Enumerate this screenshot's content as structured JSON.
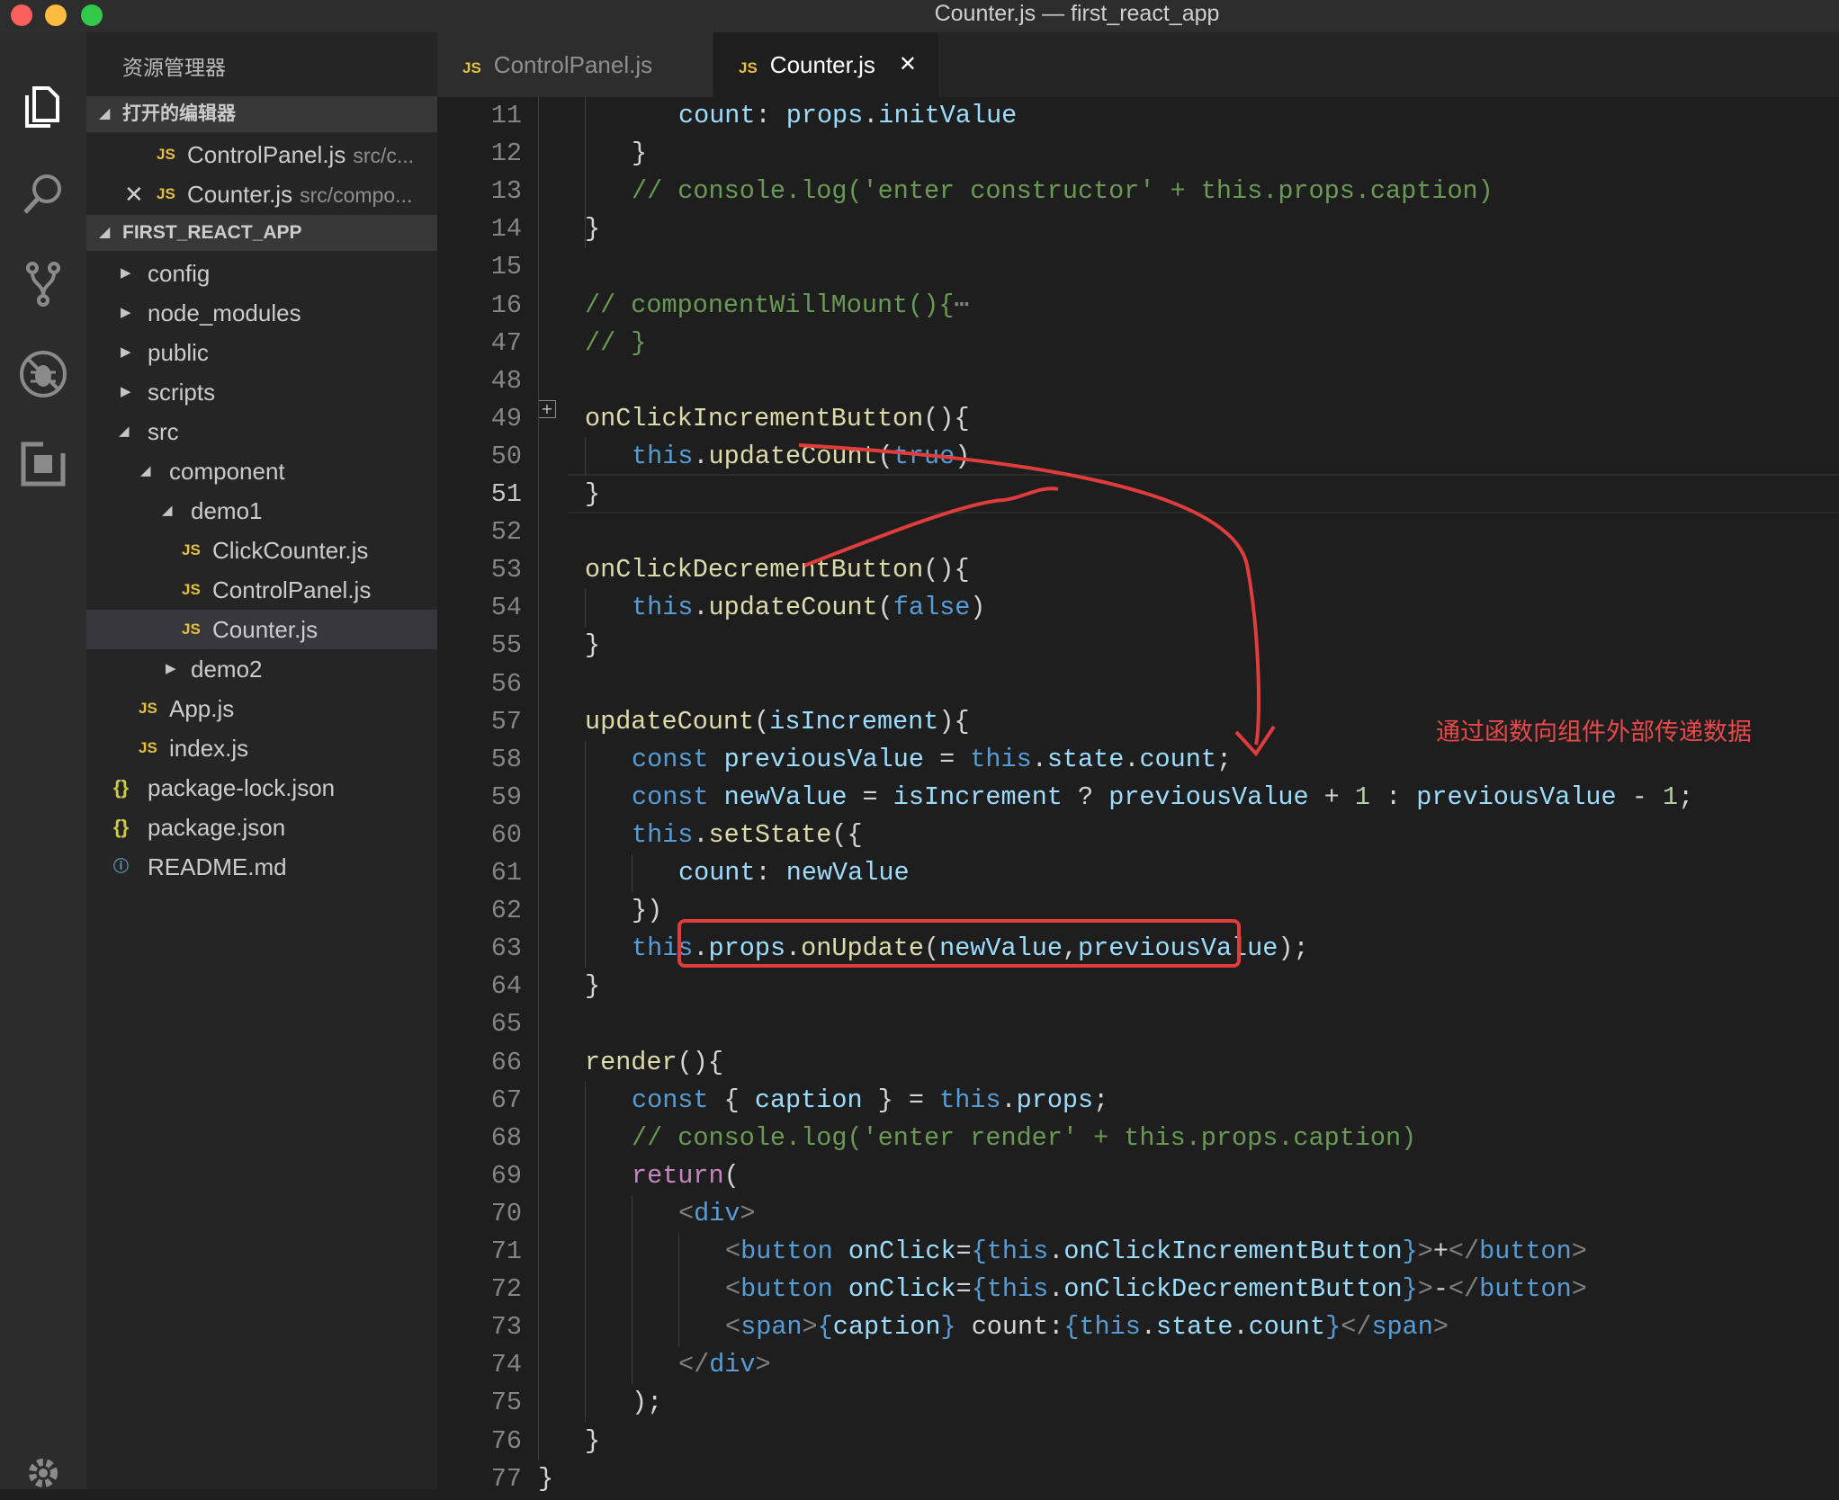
{
  "window": {
    "title": "Counter.js — first_react_app"
  },
  "activity_bar": {
    "items": [
      {
        "name": "explorer-icon"
      },
      {
        "name": "search-icon"
      },
      {
        "name": "source-control-icon"
      },
      {
        "name": "debug-icon"
      },
      {
        "name": "extensions-icon"
      },
      {
        "name": "gear-icon"
      }
    ]
  },
  "sidebar": {
    "title": "资源管理器",
    "open_editors": {
      "label": "打开的编辑器",
      "items": [
        {
          "name": "ControlPanel.js",
          "path": "src/c..."
        },
        {
          "name": "Counter.js",
          "path": "src/compo...",
          "close": "✕"
        }
      ]
    },
    "project": {
      "label": "FIRST_REACT_APP",
      "items": [
        {
          "name": "config"
        },
        {
          "name": "node_modules"
        },
        {
          "name": "public"
        },
        {
          "name": "scripts"
        },
        {
          "name": "src"
        },
        {
          "name": "component"
        },
        {
          "name": "demo1"
        },
        {
          "name": "ClickCounter.js"
        },
        {
          "name": "ControlPanel.js"
        },
        {
          "name": "Counter.js"
        },
        {
          "name": "demo2"
        },
        {
          "name": "App.js"
        },
        {
          "name": "index.js"
        },
        {
          "name": "package-lock.json"
        },
        {
          "name": "package.json"
        },
        {
          "name": "README.md"
        }
      ]
    }
  },
  "tabs": [
    {
      "label": "ControlPanel.js",
      "icon": "JS"
    },
    {
      "label": "Counter.js",
      "icon": "JS",
      "close": "✕"
    }
  ],
  "editor": {
    "line_numbers": [
      "11",
      "12",
      "13",
      "14",
      "15",
      "16",
      "47",
      "48",
      "49",
      "50",
      "51",
      "52",
      "53",
      "54",
      "55",
      "56",
      "57",
      "58",
      "59",
      "60",
      "61",
      "62",
      "63",
      "64",
      "65",
      "66",
      "67",
      "68",
      "69",
      "70",
      "71",
      "72",
      "73",
      "74",
      "75",
      "76",
      "77"
    ],
    "current_line": "51",
    "lines": [
      {
        "indent": 2,
        "tokens": [
          [
            "pr",
            "count"
          ],
          [
            "op",
            ": "
          ],
          [
            "pr",
            "props"
          ],
          [
            "op",
            "."
          ],
          [
            "pr",
            "initValue"
          ]
        ]
      },
      {
        "indent": 1,
        "tokens": [
          [
            "op",
            "}"
          ]
        ]
      },
      {
        "indent": 1,
        "tokens": [
          [
            "cm",
            "// console.log('enter constructor' + this.props.caption)"
          ]
        ]
      },
      {
        "indent": 0,
        "tokens": [
          [
            "op",
            "}"
          ]
        ]
      },
      {
        "indent": 0,
        "tokens": []
      },
      {
        "indent": 0,
        "tokens": [
          [
            "cm",
            "// componentWillMount(){"
          ],
          [
            "bt",
            "⋯"
          ]
        ]
      },
      {
        "indent": 0,
        "tokens": [
          [
            "cm",
            "// }"
          ]
        ]
      },
      {
        "indent": 0,
        "tokens": []
      },
      {
        "indent": 0,
        "tokens": [
          [
            "fn",
            "onClickIncrementButton"
          ],
          [
            "op",
            "(){"
          ]
        ]
      },
      {
        "indent": 1,
        "tokens": [
          [
            "kw",
            "this"
          ],
          [
            "op",
            "."
          ],
          [
            "fn",
            "updateCount"
          ],
          [
            "op",
            "("
          ],
          [
            "kw",
            "true"
          ],
          [
            "op",
            ")"
          ]
        ]
      },
      {
        "indent": 0,
        "tokens": [
          [
            "op",
            "}"
          ]
        ]
      },
      {
        "indent": 0,
        "tokens": []
      },
      {
        "indent": 0,
        "tokens": [
          [
            "fn",
            "onClickDecrementButton"
          ],
          [
            "op",
            "(){"
          ]
        ]
      },
      {
        "indent": 1,
        "tokens": [
          [
            "kw",
            "this"
          ],
          [
            "op",
            "."
          ],
          [
            "fn",
            "updateCount"
          ],
          [
            "op",
            "("
          ],
          [
            "kw",
            "false"
          ],
          [
            "op",
            ")"
          ]
        ]
      },
      {
        "indent": 0,
        "tokens": [
          [
            "op",
            "}"
          ]
        ]
      },
      {
        "indent": 0,
        "tokens": []
      },
      {
        "indent": 0,
        "tokens": [
          [
            "fn",
            "updateCount"
          ],
          [
            "op",
            "("
          ],
          [
            "pr",
            "isIncrement"
          ],
          [
            "op",
            "){"
          ]
        ]
      },
      {
        "indent": 1,
        "tokens": [
          [
            "kw",
            "const "
          ],
          [
            "pr",
            "previousValue"
          ],
          [
            "op",
            " = "
          ],
          [
            "kw",
            "this"
          ],
          [
            "op",
            "."
          ],
          [
            "pr",
            "state"
          ],
          [
            "op",
            "."
          ],
          [
            "pr",
            "count"
          ],
          [
            "op",
            ";"
          ]
        ]
      },
      {
        "indent": 1,
        "tokens": [
          [
            "kw",
            "const "
          ],
          [
            "pr",
            "newValue"
          ],
          [
            "op",
            " = "
          ],
          [
            "pr",
            "isIncrement"
          ],
          [
            "op",
            " ? "
          ],
          [
            "pr",
            "previousValue"
          ],
          [
            "op",
            " + "
          ],
          [
            "nu",
            "1"
          ],
          [
            "op",
            " : "
          ],
          [
            "pr",
            "previousValue"
          ],
          [
            "op",
            " - "
          ],
          [
            "nu",
            "1"
          ],
          [
            "op",
            ";"
          ]
        ]
      },
      {
        "indent": 1,
        "tokens": [
          [
            "kw",
            "this"
          ],
          [
            "op",
            "."
          ],
          [
            "fn",
            "setState"
          ],
          [
            "op",
            "({"
          ]
        ]
      },
      {
        "indent": 2,
        "tokens": [
          [
            "pr",
            "count"
          ],
          [
            "op",
            ": "
          ],
          [
            "pr",
            "newValue"
          ]
        ]
      },
      {
        "indent": 1,
        "tokens": [
          [
            "op",
            "})"
          ]
        ]
      },
      {
        "indent": 1,
        "tokens": [
          [
            "kw",
            "this"
          ],
          [
            "op",
            "."
          ],
          [
            "pr",
            "props"
          ],
          [
            "op",
            "."
          ],
          [
            "fn",
            "onUpdate"
          ],
          [
            "op",
            "("
          ],
          [
            "pr",
            "newValue"
          ],
          [
            "op",
            ","
          ],
          [
            "pr",
            "previousValue"
          ],
          [
            "op",
            ");"
          ]
        ]
      },
      {
        "indent": 0,
        "tokens": [
          [
            "op",
            "}"
          ]
        ]
      },
      {
        "indent": 0,
        "tokens": []
      },
      {
        "indent": 0,
        "tokens": [
          [
            "fn",
            "render"
          ],
          [
            "op",
            "(){"
          ]
        ]
      },
      {
        "indent": 1,
        "tokens": [
          [
            "kw",
            "const "
          ],
          [
            "op",
            "{ "
          ],
          [
            "pr",
            "caption"
          ],
          [
            "op",
            " } = "
          ],
          [
            "kw",
            "this"
          ],
          [
            "op",
            "."
          ],
          [
            "pr",
            "props"
          ],
          [
            "op",
            ";"
          ]
        ]
      },
      {
        "indent": 1,
        "tokens": [
          [
            "cm",
            "// console.log('enter render' + this.props.caption)"
          ]
        ]
      },
      {
        "indent": 1,
        "tokens": [
          [
            "ct",
            "return"
          ],
          [
            "op",
            "("
          ]
        ]
      },
      {
        "indent": 2,
        "tokens": [
          [
            "bt",
            "<"
          ],
          [
            "tg",
            "div"
          ],
          [
            "bt",
            ">"
          ]
        ]
      },
      {
        "indent": 3,
        "tokens": [
          [
            "bt",
            "<"
          ],
          [
            "tg",
            "button"
          ],
          [
            "op",
            " "
          ],
          [
            "pr",
            "onClick"
          ],
          [
            "op",
            "="
          ],
          [
            "kw",
            "{"
          ],
          [
            "kw",
            "this"
          ],
          [
            "op",
            "."
          ],
          [
            "pr",
            "onClickIncrementButton"
          ],
          [
            "kw",
            "}"
          ],
          [
            "bt",
            ">"
          ],
          [
            "op",
            "+"
          ],
          [
            "bt",
            "</"
          ],
          [
            "tg",
            "button"
          ],
          [
            "bt",
            ">"
          ]
        ]
      },
      {
        "indent": 3,
        "tokens": [
          [
            "bt",
            "<"
          ],
          [
            "tg",
            "button"
          ],
          [
            "op",
            " "
          ],
          [
            "pr",
            "onClick"
          ],
          [
            "op",
            "="
          ],
          [
            "kw",
            "{"
          ],
          [
            "kw",
            "this"
          ],
          [
            "op",
            "."
          ],
          [
            "pr",
            "onClickDecrementButton"
          ],
          [
            "kw",
            "}"
          ],
          [
            "bt",
            ">"
          ],
          [
            "op",
            "-"
          ],
          [
            "bt",
            "</"
          ],
          [
            "tg",
            "button"
          ],
          [
            "bt",
            ">"
          ]
        ]
      },
      {
        "indent": 3,
        "tokens": [
          [
            "bt",
            "<"
          ],
          [
            "tg",
            "span"
          ],
          [
            "bt",
            ">"
          ],
          [
            "kw",
            "{"
          ],
          [
            "pr",
            "caption"
          ],
          [
            "kw",
            "}"
          ],
          [
            "op",
            " count:"
          ],
          [
            "kw",
            "{"
          ],
          [
            "kw",
            "this"
          ],
          [
            "op",
            "."
          ],
          [
            "pr",
            "state"
          ],
          [
            "op",
            "."
          ],
          [
            "pr",
            "count"
          ],
          [
            "kw",
            "}"
          ],
          [
            "bt",
            "</"
          ],
          [
            "tg",
            "span"
          ],
          [
            "bt",
            ">"
          ]
        ]
      },
      {
        "indent": 2,
        "tokens": [
          [
            "bt",
            "</"
          ],
          [
            "tg",
            "div"
          ],
          [
            "bt",
            ">"
          ]
        ]
      },
      {
        "indent": 1,
        "tokens": [
          [
            "op",
            ");"
          ]
        ]
      },
      {
        "indent": 0,
        "tokens": [
          [
            "op",
            "}"
          ]
        ]
      },
      {
        "indent": -1,
        "tokens": [
          [
            "op",
            "}"
          ]
        ]
      }
    ]
  },
  "annotation": {
    "text": "通过函数向组件外部传递数据",
    "color": "#e84848"
  },
  "colors": {
    "keyword": "#569cd6",
    "function": "#dcdcaa",
    "property": "#9cdcfe",
    "comment": "#6a9955",
    "number": "#b5cea8",
    "control": "#c586c0"
  }
}
